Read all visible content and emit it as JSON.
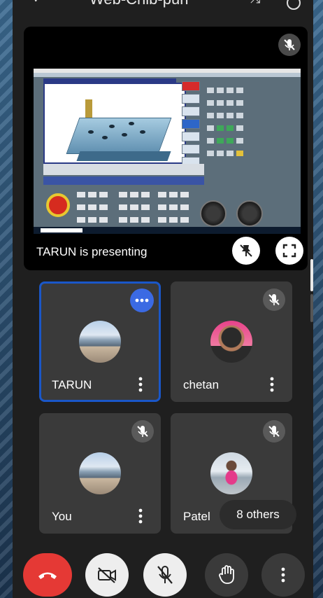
{
  "top": {
    "title": "Web-Chib-pun"
  },
  "presentation": {
    "label": "TARUN is presenting"
  },
  "participants": [
    {
      "name": "TARUN",
      "muted": false,
      "active": true,
      "avatar": "landscape"
    },
    {
      "name": "chetan",
      "muted": true,
      "active": false,
      "avatar": "person-pink"
    },
    {
      "name": "You",
      "muted": true,
      "active": false,
      "avatar": "landscape"
    },
    {
      "name": "Patel",
      "muted": true,
      "active": false,
      "avatar": "person-snow"
    }
  ],
  "others": {
    "label": "8 others"
  },
  "controls": [
    {
      "id": "end-call",
      "icon": "phone-hangup-icon",
      "color": "#e53935"
    },
    {
      "id": "camera-off",
      "icon": "camera-off-icon",
      "color": "#eeeeee"
    },
    {
      "id": "mic-off",
      "icon": "mic-off-icon",
      "color": "#eeeeee"
    },
    {
      "id": "raise-hand",
      "icon": "hand-icon",
      "color": "#3a3a3a"
    },
    {
      "id": "more-options",
      "icon": "more-vert-icon",
      "color": "#3a3a3a"
    }
  ],
  "colors": {
    "accent": "#1a57c8",
    "tile_bg": "#3a3a3a",
    "call_end": "#e53935"
  }
}
